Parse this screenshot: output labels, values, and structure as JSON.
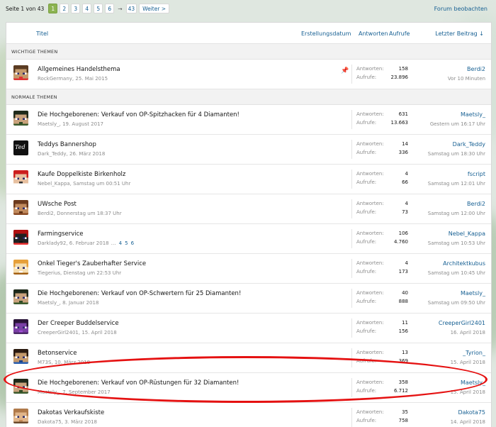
{
  "colors": {
    "accent": "#8bb351",
    "link": "#176093",
    "annotation": "#e51111"
  },
  "pagination": {
    "label": "Seite 1 von 43",
    "pages": [
      "1",
      "2",
      "3",
      "4",
      "5",
      "6"
    ],
    "current": "1",
    "ellipsis": "→",
    "last": "43",
    "next": "Weiter >"
  },
  "watch_label": "Forum beobachten",
  "columns": {
    "title": "Titel",
    "created": "Erstellungsdatum",
    "replies": "Antworten",
    "views": "Aufrufe",
    "last_post": "Letzter Beitrag ↓"
  },
  "stat_labels": {
    "replies": "Antworten:",
    "views": "Aufrufe:"
  },
  "sections": {
    "important": {
      "label": "WICHTIGE THEMEN",
      "threads": [
        {
          "title": "Allgemeines Handelsthema",
          "author": "RockGermany",
          "date": "25. Mai 2015",
          "replies": "158",
          "views": "23.896",
          "last_user": "Berdi2",
          "last_date": "Vor 10 Minuten",
          "avatar": "steve-red-avatar",
          "pinned_icon": "pin-icon"
        }
      ]
    },
    "normal": {
      "label": "NORMALE THEMEN",
      "threads": [
        {
          "title": "Die Hochgeborenen: Verkauf von OP-Spitzhacken für 4 Diamanten!",
          "author": "Maetsly_",
          "date": "19. August 2017",
          "replies": "631",
          "views": "13.663",
          "last_user": "Maetsly_",
          "last_date": "Gestern um 16:17 Uhr",
          "avatar": "dark-hair-avatar"
        },
        {
          "title": "Teddys Bannershop",
          "author": "Dark_Teddy",
          "date": "26. März 2018",
          "replies": "14",
          "views": "336",
          "last_user": "Dark_Teddy",
          "last_date": "Samstag um 18:30 Uhr",
          "avatar": "ted-logo-avatar",
          "avatar_text": "Ted"
        },
        {
          "title": "Kaufe Doppelkiste Birkenholz",
          "author": "Nebel_Kappa",
          "date": "Samstag um 00:51 Uhr",
          "replies": "4",
          "views": "66",
          "last_user": "fscript",
          "last_date": "Samstag um 12:01 Uhr",
          "avatar": "red-hat-avatar"
        },
        {
          "title": "UWsche Post",
          "author": "Berdi2",
          "date": "Donnerstag um 18:37 Uhr",
          "replies": "4",
          "views": "73",
          "last_user": "Berdi2",
          "last_date": "Samstag um 12:00 Uhr",
          "avatar": "brown-hair-avatar"
        },
        {
          "title": "Farmingservice",
          "author": "Darklady92",
          "date": "6. Februar 2018",
          "pages": [
            "4",
            "5",
            "6"
          ],
          "replies": "106",
          "views": "4.760",
          "last_user": "Nebel_Kappa",
          "last_date": "Samstag um 10:53 Uhr",
          "avatar": "red-black-avatar"
        },
        {
          "title": "Onkel Tieger's Zauberhafter Service",
          "author": "Tiegerius",
          "date": "Dienstag um 22:53 Uhr",
          "replies": "4",
          "views": "173",
          "last_user": "Architektkubus",
          "last_date": "Samstag um 10:45 Uhr",
          "avatar": "tiger-avatar"
        },
        {
          "title": "Die Hochgeborenen: Verkauf von OP-Schwertern für 25 Diamanten!",
          "author": "Maetsly_",
          "date": "8. Januar 2018",
          "replies": "40",
          "views": "888",
          "last_user": "Maetsly_",
          "last_date": "Samstag um 09:50 Uhr",
          "avatar": "dark-hair-avatar"
        },
        {
          "title": "Der Creeper Buddelservice",
          "author": "CreeperGirl2401",
          "date": "15. April 2018",
          "replies": "11",
          "views": "156",
          "last_user": "CreeperGirl2401",
          "last_date": "16. April 2018",
          "avatar": "purple-avatar"
        },
        {
          "title": "Betonservice",
          "author": "M73S",
          "date": "10. März 2018",
          "replies": "13",
          "views": "369",
          "last_user": "_Tyrion_",
          "last_date": "15. April 2018",
          "avatar": "blue-shirt-avatar"
        },
        {
          "title": "Die Hochgeborenen: Verkauf von OP-Rüstungen für 32 Diamanten!",
          "author": "Maetsly_",
          "date": "7. September 2017",
          "replies": "358",
          "views": "6.712",
          "last_user": "Maetsly_",
          "last_date": "15. April 2018",
          "avatar": "dark-hair-avatar",
          "highlighted": true
        },
        {
          "title": "Dakotas Verkaufskiste",
          "author": "Dakota75",
          "date": "3. März 2018",
          "replies": "35",
          "views": "758",
          "last_user": "Dakota75",
          "last_date": "14. April 2018",
          "avatar": "tan-hair-avatar"
        }
      ]
    }
  }
}
